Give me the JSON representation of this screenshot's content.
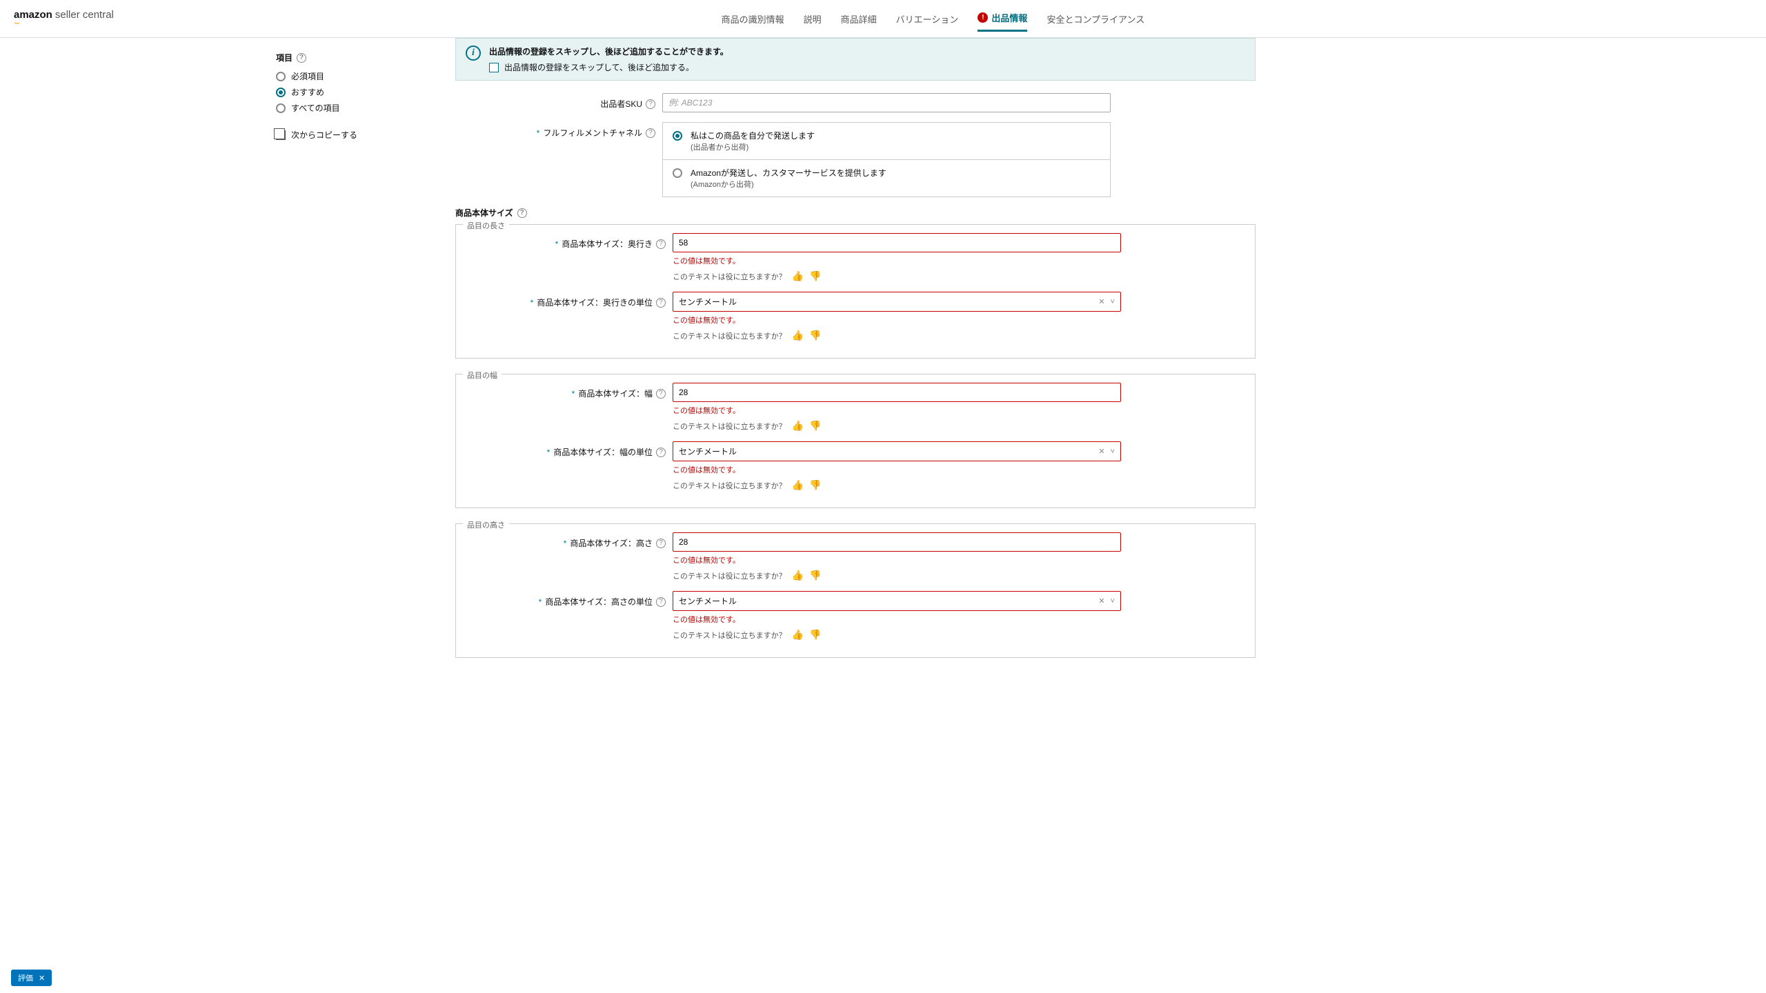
{
  "logo": {
    "text1": "amazon",
    "text2": "seller central"
  },
  "tabs": {
    "t1": "商品の識別情報",
    "t2": "説明",
    "t3": "商品詳細",
    "t4": "バリエーション",
    "t5": "出品情報",
    "t6": "安全とコンプライアンス"
  },
  "sidebar": {
    "title": "項目",
    "r1": "必須項目",
    "r2": "おすすめ",
    "r3": "すべての項目",
    "copy": "次からコピーする"
  },
  "banner": {
    "title": "出品情報の登録をスキップし、後ほど追加することができます。",
    "chk": "出品情報の登録をスキップして、後ほど追加する。"
  },
  "sku": {
    "label": "出品者SKU",
    "placeholder": "例: ABC123"
  },
  "fulfill": {
    "label": "フルフィルメントチャネル",
    "opt1": "私はこの商品を自分で発送します",
    "opt1sub": "(出品者から出荷)",
    "opt2": "Amazonが発送し、カスタマーサービスを提供します",
    "opt2sub": "(Amazonから出荷)"
  },
  "section_size": "商品本体サイズ",
  "groups": {
    "g1": "品目の長さ",
    "g2": "品目の幅",
    "g3": "品目の高さ"
  },
  "fields": {
    "depth": {
      "label": "商品本体サイズ：奥行き",
      "value": "58"
    },
    "depth_unit": {
      "label": "商品本体サイズ：奥行きの単位",
      "value": "センチメートル"
    },
    "width": {
      "label": "商品本体サイズ：幅",
      "value": "28"
    },
    "width_unit": {
      "label": "商品本体サイズ：幅の単位",
      "value": "センチメートル"
    },
    "height": {
      "label": "商品本体サイズ：高さ",
      "value": "28"
    },
    "height_unit": {
      "label": "商品本体サイズ：高さの単位",
      "value": "センチメートル"
    }
  },
  "err_text": "この値は無効です。",
  "hint_text": "このテキストは役に立ちますか？",
  "feedback": "評価"
}
